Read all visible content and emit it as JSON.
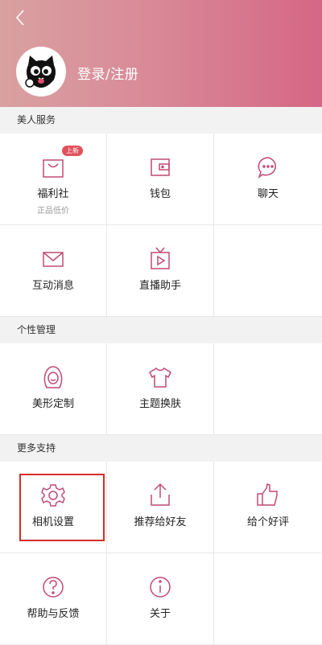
{
  "header": {
    "login_label": "登录/注册"
  },
  "sections": [
    {
      "title": "美人服务",
      "items": [
        {
          "label": "福利社",
          "sub": "正品低价",
          "badge": "上新",
          "icon": "bag-icon"
        },
        {
          "label": "钱包",
          "icon": "wallet-icon"
        },
        {
          "label": "聊天",
          "icon": "chat-bubble-icon"
        },
        {
          "label": "互动消息",
          "icon": "envelope-icon"
        },
        {
          "label": "直播助手",
          "icon": "tv-play-icon"
        }
      ]
    },
    {
      "title": "个性管理",
      "items": [
        {
          "label": "美形定制",
          "icon": "face-icon"
        },
        {
          "label": "主题换肤",
          "icon": "shirt-icon"
        }
      ]
    },
    {
      "title": "更多支持",
      "items": [
        {
          "label": "相机设置",
          "icon": "gear-icon"
        },
        {
          "label": "推荐给好友",
          "icon": "share-icon"
        },
        {
          "label": "给个好评",
          "icon": "thumbs-up-icon"
        },
        {
          "label": "帮助与反馈",
          "icon": "help-icon"
        },
        {
          "label": "关于",
          "icon": "info-icon"
        }
      ]
    }
  ],
  "colors": {
    "icon": "#c14a74",
    "header_start": "#d9a1a1",
    "header_end": "#d56785",
    "highlight": "#d42c2c"
  }
}
